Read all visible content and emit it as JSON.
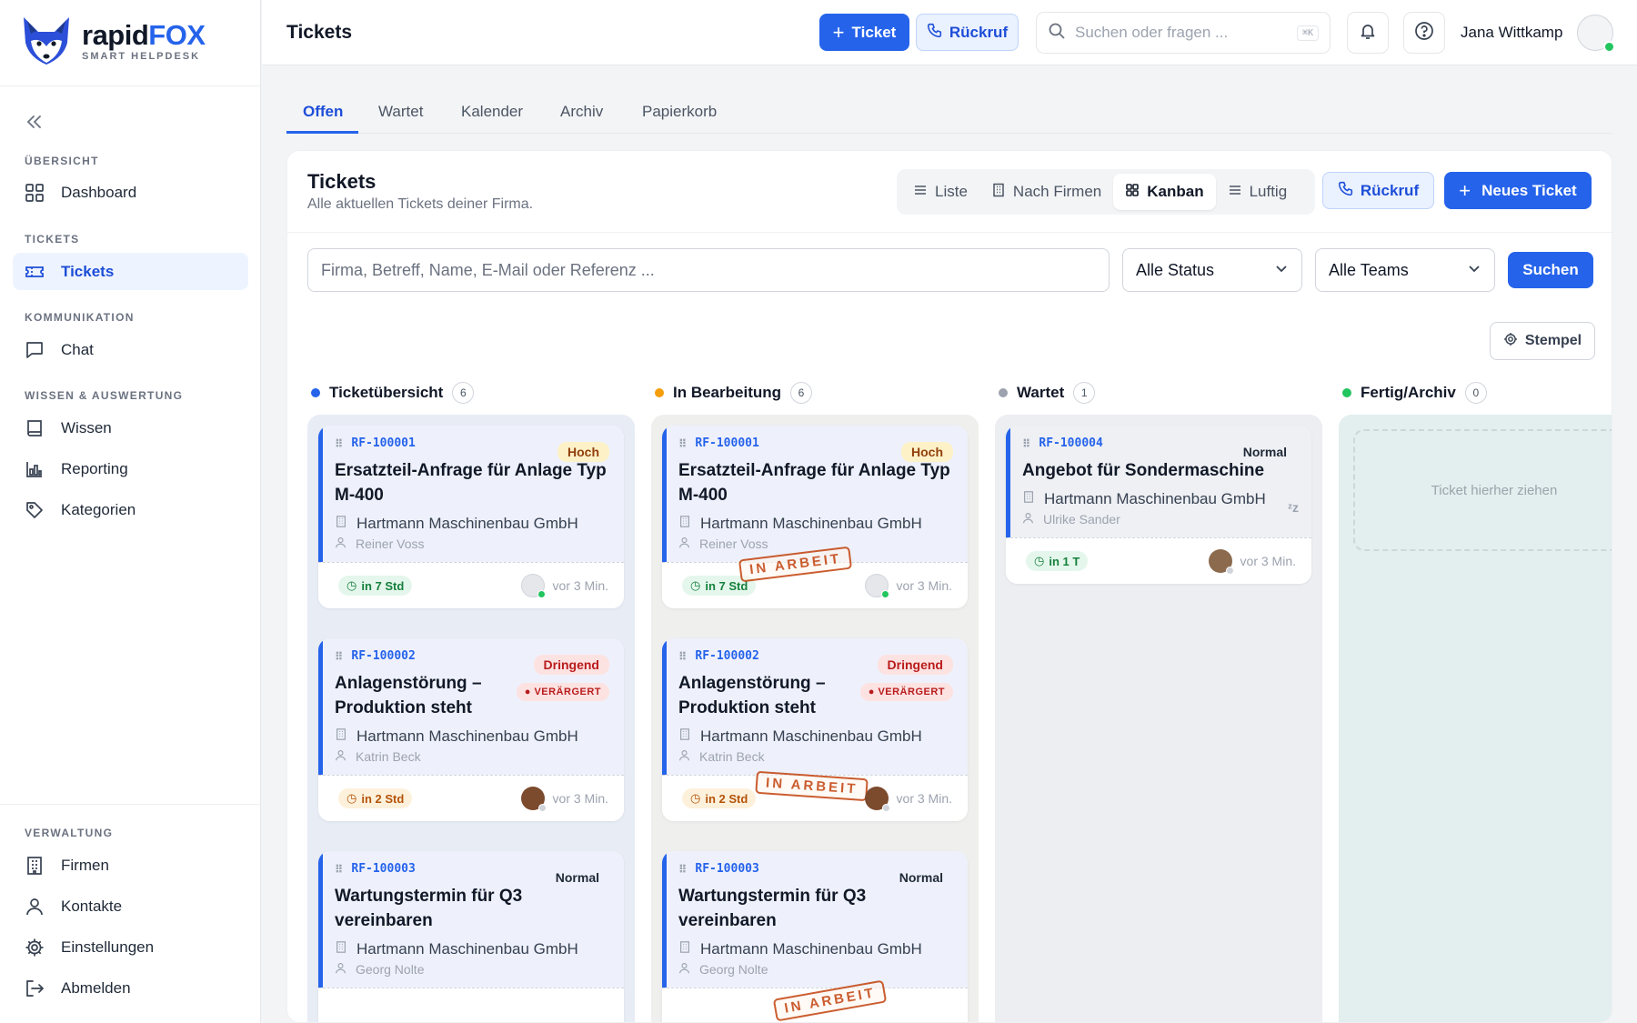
{
  "brand": {
    "name_part1": "rapid",
    "name_part2": "FOX",
    "tagline": "SMART HELPDESK"
  },
  "sidebar": {
    "sections": [
      {
        "label": "ÜBERSICHT",
        "items": [
          {
            "label": "Dashboard",
            "icon": "grid-icon"
          }
        ]
      },
      {
        "label": "TICKETS",
        "items": [
          {
            "label": "Tickets",
            "icon": "ticket-icon",
            "active": true
          }
        ]
      },
      {
        "label": "KOMMUNIKATION",
        "items": [
          {
            "label": "Chat",
            "icon": "chat-icon"
          }
        ]
      },
      {
        "label": "WISSEN & AUSWERTUNG",
        "items": [
          {
            "label": "Wissen",
            "icon": "book-icon"
          },
          {
            "label": "Reporting",
            "icon": "chart-icon"
          },
          {
            "label": "Kategorien",
            "icon": "tag-icon"
          }
        ]
      },
      {
        "label": "VERWALTUNG",
        "items": [
          {
            "label": "Firmen",
            "icon": "building-icon"
          },
          {
            "label": "Kontakte",
            "icon": "user-icon"
          },
          {
            "label": "Einstellungen",
            "icon": "gear-icon"
          },
          {
            "label": "Abmelden",
            "icon": "logout-icon"
          }
        ]
      }
    ]
  },
  "header": {
    "title": "Tickets",
    "new_ticket": "Ticket",
    "callback": "Rückruf",
    "search_placeholder": "Suchen oder fragen ...",
    "search_shortcut": "⌘K",
    "user_name": "Jana Wittkamp"
  },
  "tabs": [
    "Offen",
    "Wartet",
    "Kalender",
    "Archiv",
    "Papierkorb"
  ],
  "panel": {
    "title": "Tickets",
    "subtitle": "Alle aktuellen Tickets deiner Firma.",
    "views": [
      "Liste",
      "Nach Firmen",
      "Kanban",
      "Luftig"
    ],
    "active_view": "Kanban",
    "callback": "Rückruf",
    "new_ticket": "Neues Ticket",
    "filter_placeholder": "Firma, Betreff, Name, E-Mail oder Referenz ...",
    "status_select": "Alle Status",
    "team_select": "Alle Teams",
    "search_button": "Suchen",
    "stamp_button": "Stempel"
  },
  "columns": [
    {
      "name": "Ticketübersicht",
      "count": "6",
      "color": "#2563eb"
    },
    {
      "name": "In Bearbeitung",
      "count": "6",
      "color": "#f59e0b"
    },
    {
      "name": "Wartet",
      "count": "1",
      "color": "#9ca3af"
    },
    {
      "name": "Fertig/Archiv",
      "count": "0",
      "color": "#22c55e"
    }
  ],
  "tickets": {
    "t1": {
      "id": "RF-100001",
      "priority": "Hoch",
      "title": "Ersatzteil-Anfrage für Anlage Typ M-400",
      "company": "Hartmann Maschinenbau GmbH",
      "contact": "Reiner Voss",
      "due": "in 7 Std",
      "age": "vor 3 Min."
    },
    "t2": {
      "id": "RF-100002",
      "priority": "Dringend",
      "mood": "VERÄRGERT",
      "title": "Anlagenstörung – Produktion steht",
      "company": "Hartmann Maschinenbau GmbH",
      "contact": "Katrin Beck",
      "due": "in 2 Std",
      "age": "vor 3 Min."
    },
    "t3": {
      "id": "RF-100003",
      "priority": "Normal",
      "title": "Wartungstermin für Q3 vereinbaren",
      "company": "Hartmann Maschinenbau GmbH",
      "contact": "Georg Nolte"
    },
    "t4": {
      "id": "RF-100004",
      "priority": "Normal",
      "title": "Angebot für Sondermaschine",
      "company": "Hartmann Maschinenbau GmbH",
      "contact": "Ulrike Sander",
      "due": "in 1 T",
      "age": "vor 3 Min.",
      "snooze": "ᶻz"
    }
  },
  "stamp_text": "IN ARBEIT",
  "drop_hint": "Ticket hierher ziehen"
}
